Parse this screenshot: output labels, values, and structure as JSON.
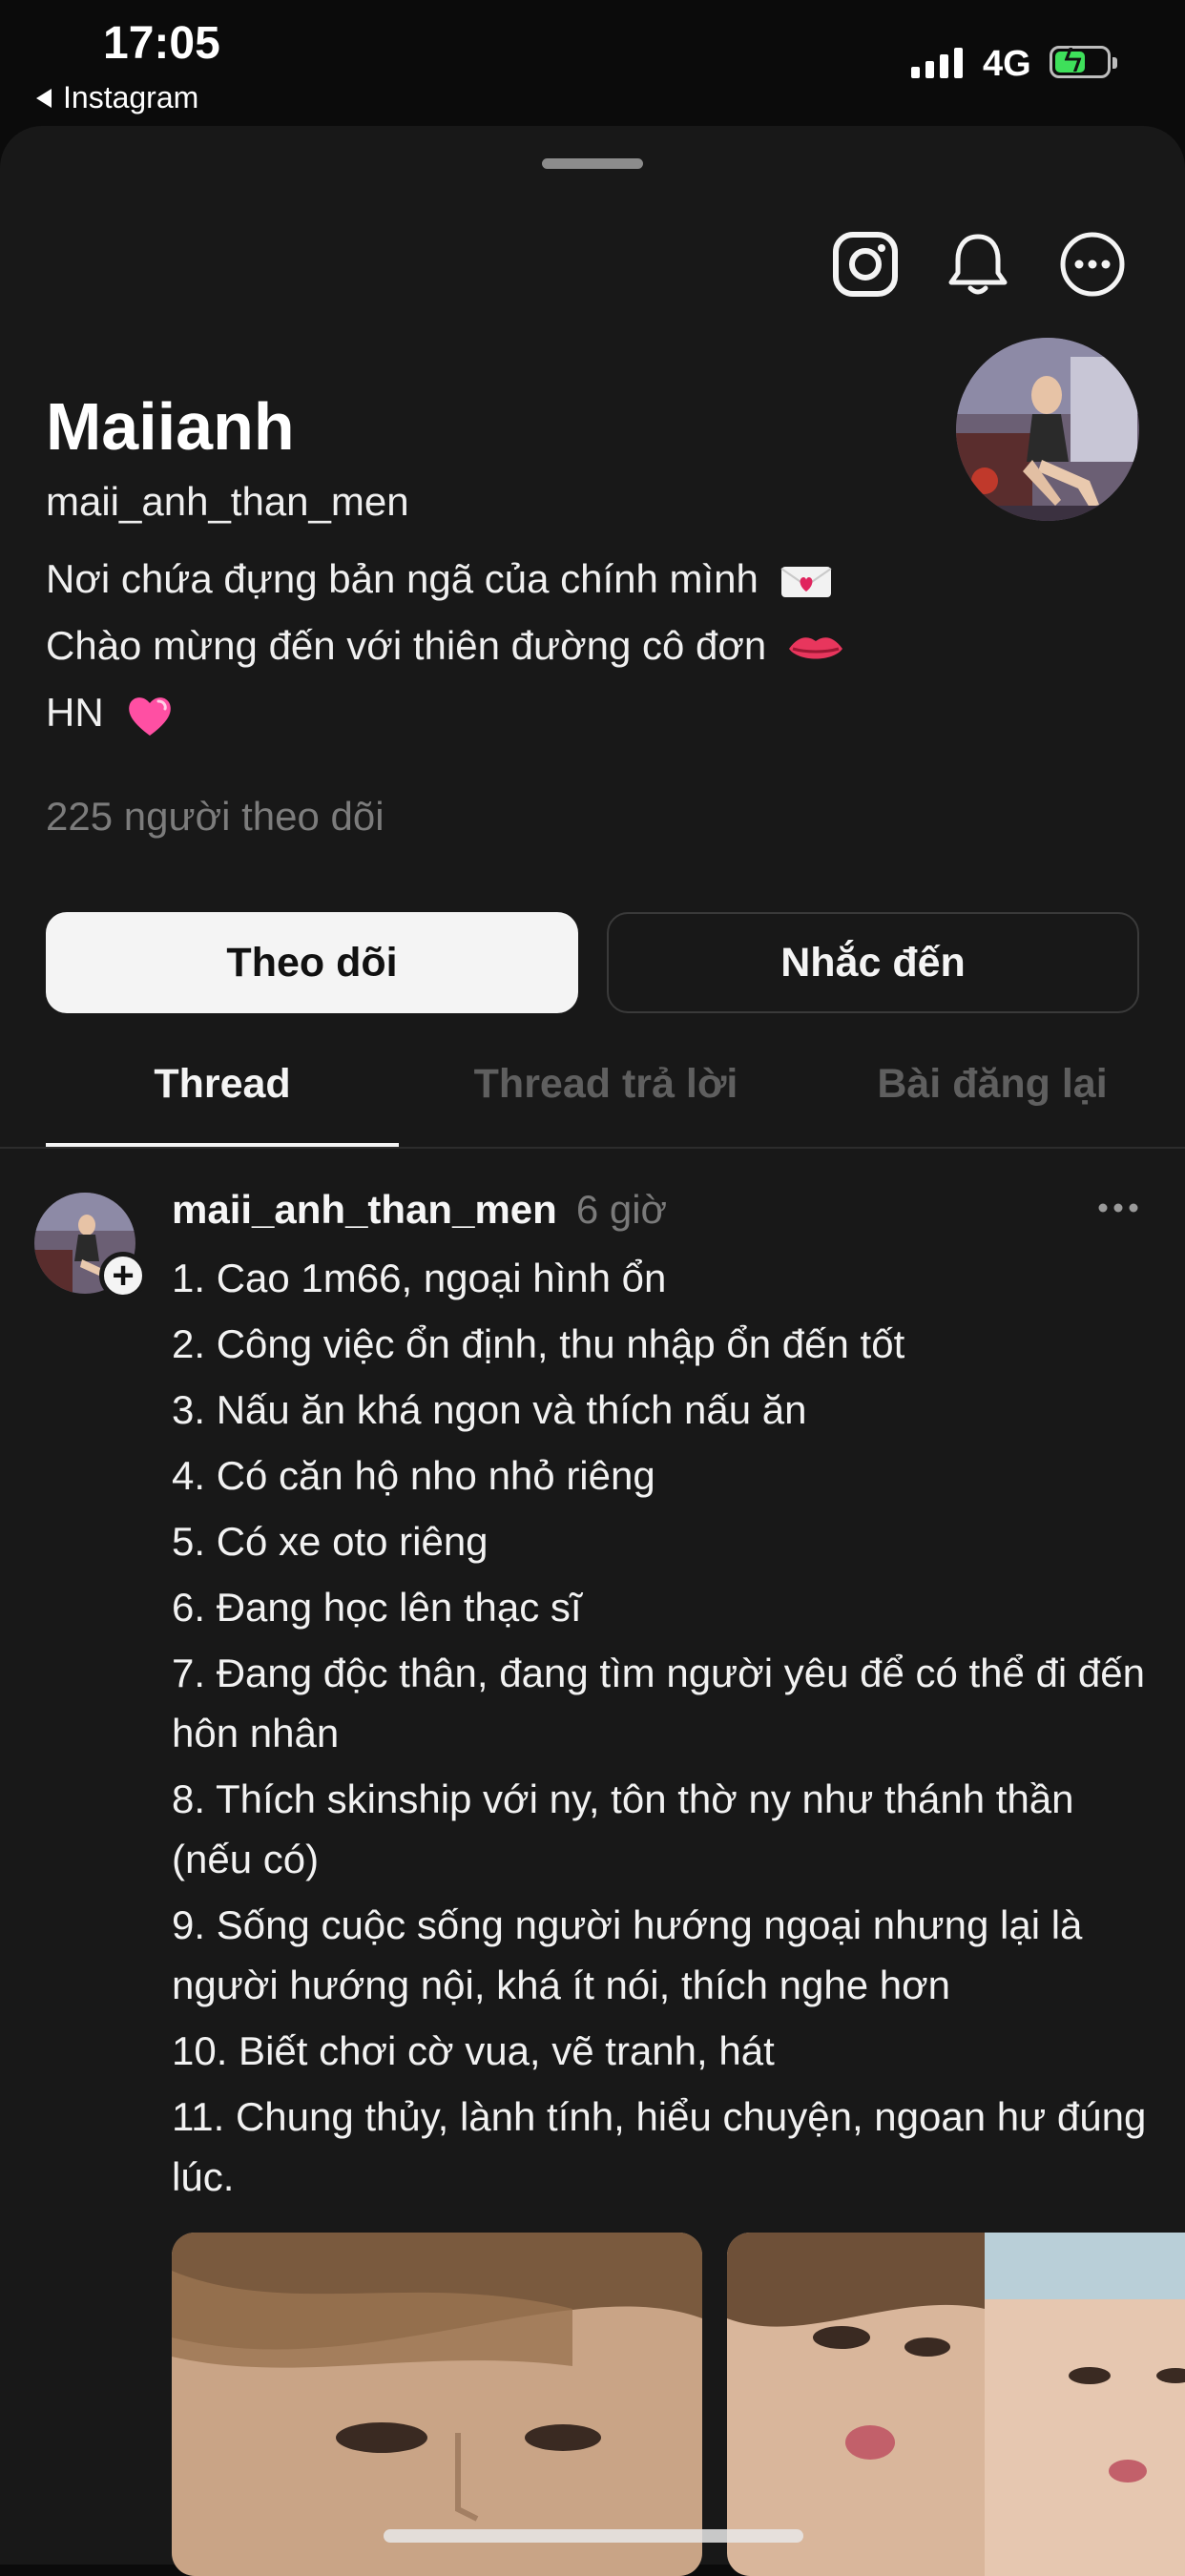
{
  "status_bar": {
    "time": "17:05",
    "back_app": "Instagram",
    "network": "4G",
    "battery_level": 0.6
  },
  "header_icons": [
    "instagram-icon",
    "bell-icon",
    "more-icon"
  ],
  "profile": {
    "display_name": "Maiianh",
    "username": "maii_anh_than_men",
    "bio_lines": [
      {
        "text": "Nơi chứa đựng bản ngã của chính mình",
        "emoji": "love-letter-emoji"
      },
      {
        "text": "Chào mừng đến với thiên đường cô đơn",
        "emoji": "lips-emoji"
      },
      {
        "text": "HN",
        "emoji": "pink-heart-emoji"
      }
    ],
    "followers": "225 người theo dõi"
  },
  "buttons": {
    "follow": "Theo dõi",
    "mention": "Nhắc đến"
  },
  "tabs": [
    {
      "label": "Thread",
      "active": true
    },
    {
      "label": "Thread trả lời",
      "active": false
    },
    {
      "label": "Bài đăng lại",
      "active": false
    }
  ],
  "post": {
    "username": "maii_anh_than_men",
    "time": "6 giờ",
    "lines": [
      "1. Cao 1m66, ngoại hình ổn",
      "2. Công việc ổn định, thu nhập ổn đến tốt",
      "3. Nấu ăn khá ngon và thích nấu ăn",
      "4. Có căn hộ nho nhỏ riêng",
      "5. Có xe oto riêng",
      "6. Đang học lên thạc sĩ",
      "7. Đang độc thân, đang tìm người yêu để có thể đi đến hôn nhân",
      "8. Thích skinship với ny, tôn thờ ny như thánh thần (nếu có)",
      "9. Sống cuộc sống người hướng ngoại nhưng lại là người hướng nội, khá ít nói, thích nghe hơn",
      "10. Biết chơi cờ vua, vẽ tranh, hát",
      "11. Chung thủy, lành tính, hiểu chuyện, ngoan hư đúng lúc."
    ]
  },
  "colors": {
    "background": "#181818",
    "text_primary": "#f3f3f3",
    "text_muted": "#7a7a7a",
    "tab_inactive": "#5f5f5f",
    "battery_green": "#3ee05a"
  }
}
